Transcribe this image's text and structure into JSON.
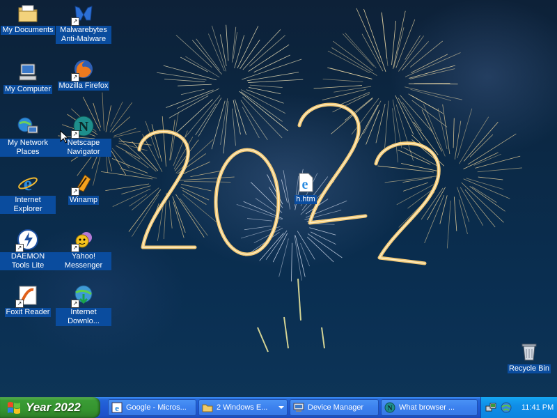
{
  "desktop": {
    "wallpaper_text": "2022",
    "icons": [
      {
        "label": "My Documents",
        "icon": "folder-documents-icon"
      },
      {
        "label": "Malwarebytes Anti-Malware",
        "icon": "malwarebytes-icon",
        "shortcut": true
      },
      {
        "label": "My Computer",
        "icon": "computer-icon"
      },
      {
        "label": "Mozilla Firefox",
        "icon": "firefox-icon",
        "shortcut": true
      },
      {
        "label": "My Network Places",
        "icon": "network-places-icon"
      },
      {
        "label": "Netscape Navigator",
        "icon": "netscape-icon",
        "shortcut": true
      },
      {
        "label": "Internet Explorer",
        "icon": "internet-explorer-icon"
      },
      {
        "label": "Winamp",
        "icon": "winamp-icon",
        "shortcut": true
      },
      {
        "label": "DAEMON Tools Lite",
        "icon": "daemon-tools-icon",
        "shortcut": true
      },
      {
        "label": "Yahoo! Messenger",
        "icon": "yahoo-messenger-icon",
        "shortcut": true
      },
      {
        "label": "Foxit Reader",
        "icon": "foxit-reader-icon",
        "shortcut": true
      },
      {
        "label": "Internet Downlo...",
        "icon": "internet-download-manager-icon",
        "shortcut": true
      },
      {
        "label": "h.htm",
        "icon": "html-file-icon"
      },
      {
        "label": "Recycle Bin",
        "icon": "recycle-bin-icon"
      }
    ]
  },
  "taskbar": {
    "start_label": "Year 2022",
    "tasks": [
      {
        "label": "Google - Micros...",
        "icon": "ie-window-icon"
      },
      {
        "label": "2 Windows E...",
        "icon": "folder-icon",
        "grouped": true
      },
      {
        "label": "Device Manager",
        "icon": "device-manager-icon"
      },
      {
        "label": "What browser ...",
        "icon": "netscape-icon"
      }
    ],
    "tray": {
      "icons": [
        "network-tray-icon",
        "globe-tray-icon"
      ],
      "clock": "11:41 PM"
    }
  },
  "colors": {
    "taskbar_blue": "#2059d4",
    "start_green": "#3a9c35",
    "tray_blue": "#0f8ee8",
    "icon_label_bg": "#0a4c9e"
  }
}
